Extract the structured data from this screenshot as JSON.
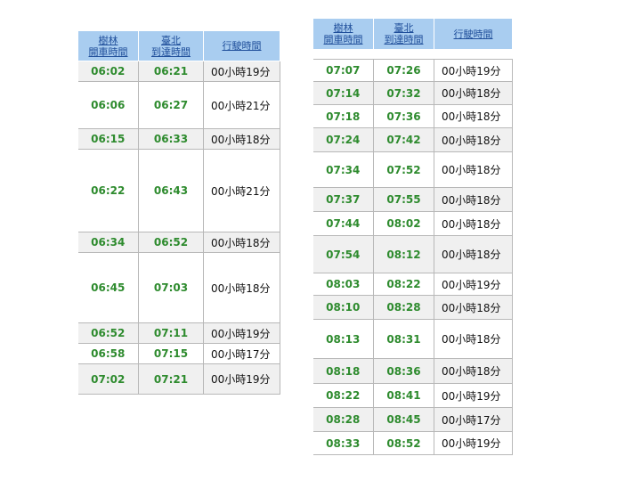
{
  "left_table": {
    "headers": [
      "樹林\n開車時間",
      "臺北\n到達時間",
      "行駛時間"
    ],
    "rows": [
      {
        "dep": "06:02",
        "arr": "06:21",
        "dur": "00小時19分"
      },
      {
        "dep": "06:06",
        "arr": "06:27",
        "dur": "00小時21分"
      },
      {
        "dep": "06:15",
        "arr": "06:33",
        "dur": "00小時18分"
      },
      {
        "dep": "06:22",
        "arr": "06:43",
        "dur": "00小時21分"
      },
      {
        "dep": "06:34",
        "arr": "06:52",
        "dur": "00小時18分"
      },
      {
        "dep": "06:45",
        "arr": "07:03",
        "dur": "00小時18分"
      },
      {
        "dep": "06:52",
        "arr": "07:11",
        "dur": "00小時19分"
      },
      {
        "dep": "06:58",
        "arr": "07:15",
        "dur": "00小時17分"
      },
      {
        "dep": "07:02",
        "arr": "07:21",
        "dur": "00小時19分"
      }
    ]
  },
  "right_table": {
    "headers": [
      "樹林\n開車時間",
      "臺北\n到達時間",
      "行駛時間"
    ],
    "rows": [
      {
        "dep": "07:07",
        "arr": "07:26",
        "dur": "00小時19分"
      },
      {
        "dep": "07:14",
        "arr": "07:32",
        "dur": "00小時18分"
      },
      {
        "dep": "07:18",
        "arr": "07:36",
        "dur": "00小時18分"
      },
      {
        "dep": "07:24",
        "arr": "07:42",
        "dur": "00小時18分"
      },
      {
        "dep": "07:34",
        "arr": "07:52",
        "dur": "00小時18分"
      },
      {
        "dep": "07:37",
        "arr": "07:55",
        "dur": "00小時18分"
      },
      {
        "dep": "07:44",
        "arr": "08:02",
        "dur": "00小時18分"
      },
      {
        "dep": "07:54",
        "arr": "08:12",
        "dur": "00小時18分"
      },
      {
        "dep": "08:03",
        "arr": "08:22",
        "dur": "00小時19分"
      },
      {
        "dep": "08:10",
        "arr": "08:28",
        "dur": "00小時18分"
      },
      {
        "dep": "08:13",
        "arr": "08:31",
        "dur": "00小時18分"
      },
      {
        "dep": "08:18",
        "arr": "08:36",
        "dur": "00小時18分"
      },
      {
        "dep": "08:22",
        "arr": "08:41",
        "dur": "00小時19分"
      },
      {
        "dep": "08:28",
        "arr": "08:45",
        "dur": "00小時17分"
      },
      {
        "dep": "08:33",
        "arr": "08:52",
        "dur": "00小時19分"
      }
    ]
  }
}
